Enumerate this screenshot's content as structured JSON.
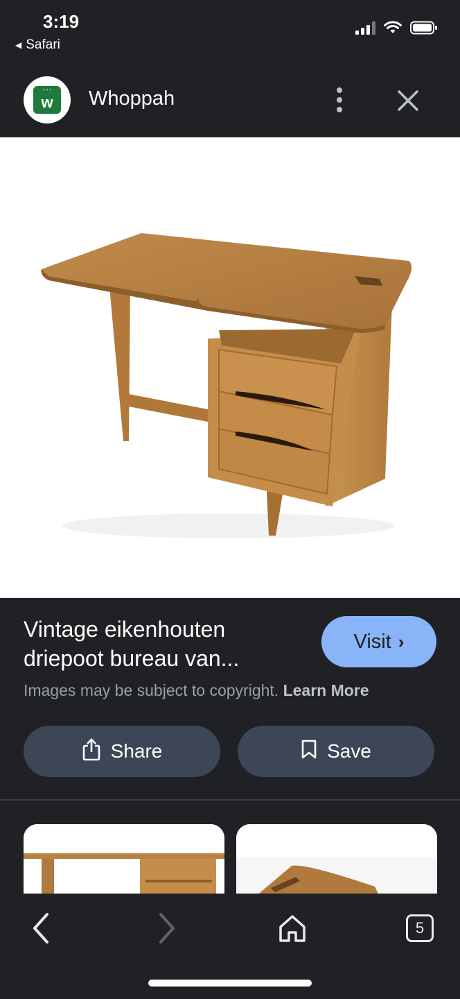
{
  "status_bar": {
    "time": "3:19",
    "back_app_label": "Safari"
  },
  "header": {
    "site_name": "Whoppah",
    "logo_letter": "w"
  },
  "result": {
    "title_line1": "Vintage eikenhouten",
    "title_line2": "driepoot bureau van...",
    "visit_label": "Visit",
    "copyright_text": "Images may be subject to copyright.",
    "learn_more_label": "Learn More",
    "share_label": "Share",
    "save_label": "Save"
  },
  "toolbar": {
    "tabs_count": "5"
  },
  "colors": {
    "background": "#202124",
    "visit_button": "#8ab4f8",
    "action_button": "#3c4657",
    "brand_green": "#1f7a3c"
  },
  "icons": [
    "back-chevron-icon",
    "forward-chevron-icon",
    "home-icon",
    "tabs-icon",
    "share-icon",
    "bookmark-icon",
    "kebab-menu-icon",
    "close-icon",
    "signal-icon",
    "wifi-icon",
    "battery-icon"
  ]
}
